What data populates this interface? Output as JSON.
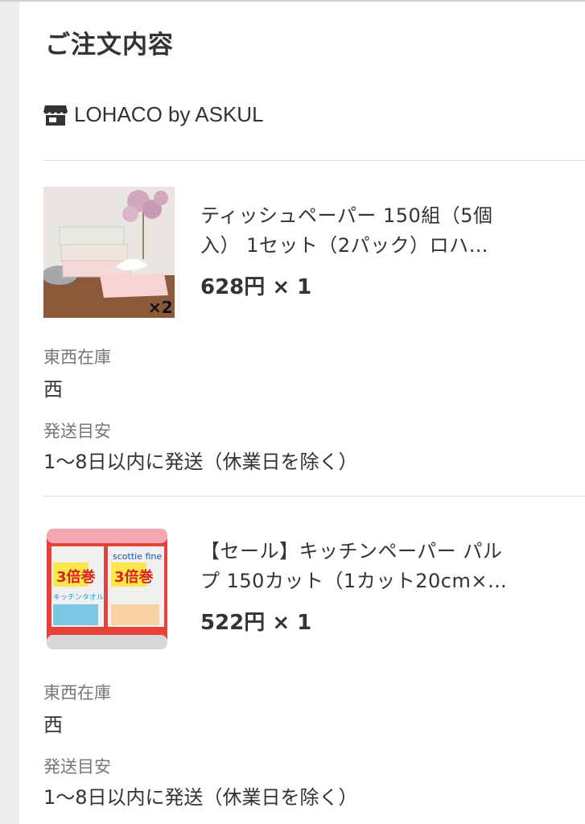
{
  "order": {
    "title": "ご注文内容",
    "shop_name": "LOHACO by ASKUL",
    "items": [
      {
        "name_line1": "ティッシュペーパー 150組（5個",
        "name_line2": "入） 1セット（2パック）ロハ…",
        "price": "628円 × 1",
        "badge": "×2",
        "stock_label": "東西在庫",
        "stock_value": "西",
        "ship_label": "発送目安",
        "ship_value": "1〜8日以内に発送（休業日を除く）"
      },
      {
        "name_line1": "【セール】キッチンペーパー パル",
        "name_line2": "プ 150カット（1カット20cm×…",
        "price": "522円 × 1",
        "pack_brand": "scottie fine",
        "pack_big": "3倍巻",
        "pack_sub": "キッチンタオル",
        "stock_label": "東西在庫",
        "stock_value": "西",
        "ship_label": "発送目安",
        "ship_value": "1〜8日以内に発送（休業日を除く）"
      }
    ]
  }
}
